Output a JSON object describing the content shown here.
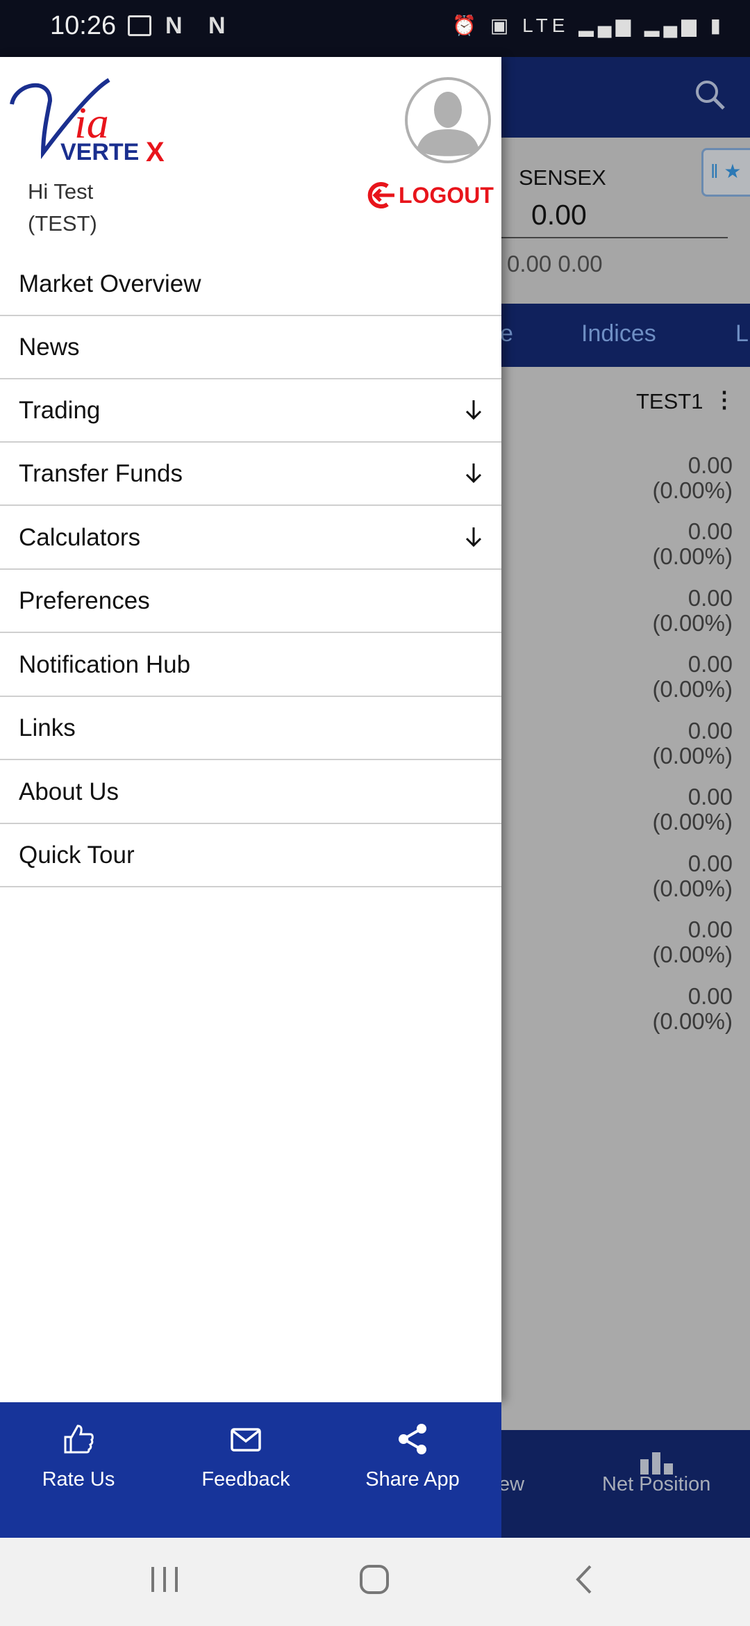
{
  "status_bar": {
    "time": "10:26",
    "left_icons": "N N",
    "right_icons": "LTE"
  },
  "drawer": {
    "logo_text": "Via VERTEX",
    "greeting": "Hi Test",
    "user_code": "(TEST)",
    "logout_label": "LOGOUT",
    "menu": [
      {
        "label": "Market Overview",
        "expandable": false
      },
      {
        "label": "News",
        "expandable": false
      },
      {
        "label": "Trading",
        "expandable": true
      },
      {
        "label": "Transfer Funds",
        "expandable": true
      },
      {
        "label": "Calculators",
        "expandable": true
      },
      {
        "label": "Preferences",
        "expandable": false
      },
      {
        "label": "Notification Hub",
        "expandable": false
      },
      {
        "label": "Links",
        "expandable": false
      },
      {
        "label": "About Us",
        "expandable": false
      },
      {
        "label": "Quick Tour",
        "expandable": false
      }
    ],
    "footer": [
      {
        "label": "Rate Us",
        "icon": "thumbs-up-icon"
      },
      {
        "label": "Feedback",
        "icon": "mail-icon"
      },
      {
        "label": "Share App",
        "icon": "share-icon"
      }
    ]
  },
  "background": {
    "index_name": "SENSEX",
    "index_value": "0.00",
    "index_change": "0.00 0.00",
    "tabs": [
      "e",
      "Indices",
      "L"
    ],
    "watchlist_name": "TEST1",
    "rows": [
      {
        "value": "0.00",
        "pct": "(0.00%)"
      },
      {
        "value": "0.00",
        "pct": "(0.00%)"
      },
      {
        "value": "0.00",
        "pct": "(0.00%)"
      },
      {
        "value": "0.00",
        "pct": "(0.00%)"
      },
      {
        "value": "0.00",
        "pct": "(0.00%)"
      },
      {
        "value": "0.00",
        "pct": "(0.00%)"
      },
      {
        "value": "0.00",
        "pct": "(0.00%)"
      },
      {
        "value": "0.00",
        "pct": "(0.00%)"
      },
      {
        "value": "0.00",
        "pct": "(0.00%)"
      }
    ],
    "bottom_nav": [
      "ew",
      "Net Position"
    ]
  },
  "colors": {
    "drawer_footer": "#17349a",
    "header": "#10215c",
    "logout": "#e8141b",
    "logo_blue": "#1a2f8f"
  }
}
